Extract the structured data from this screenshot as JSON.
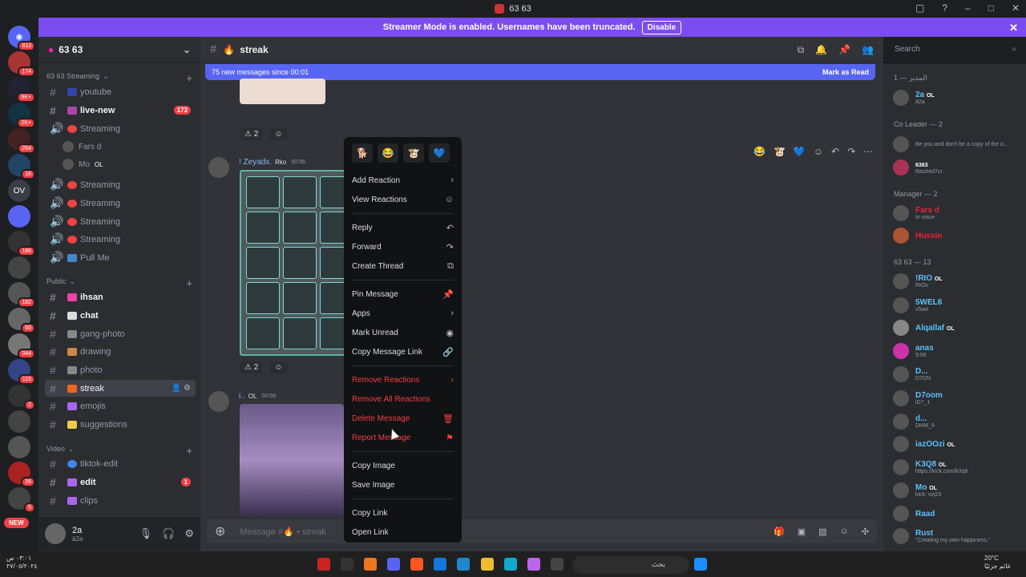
{
  "window": {
    "title": "63 63"
  },
  "banner": {
    "text": "Streamer Mode is enabled. Usernames have been truncated.",
    "button": "Disable"
  },
  "guild_badges": [
    "813",
    "174",
    "9K+",
    "2K+",
    "264",
    "16",
    "OV",
    "186",
    "182",
    "60",
    "344",
    "115",
    "2",
    "26",
    "5",
    "NEW"
  ],
  "server": {
    "name": "63 63"
  },
  "sidebar": {
    "cat_streaming": "63 63 Streaming",
    "cat_public": "Public",
    "cat_video": "Video",
    "ch_youtube": "youtube",
    "ch_livenew": "live-new",
    "ch_livenew_count": "173",
    "voice1": "Streaming",
    "voice_user1": "Fars d",
    "voice_user2": "Mo",
    "voice_user2_tag": "OL",
    "voice2": "Streaming",
    "voice3": "Streaming",
    "voice4": "Streaming",
    "voice5": "Streaming",
    "pull": "Pull Me",
    "ch_ihsan": "ihsan",
    "ch_chat": "chat",
    "ch_gang": "gang-photo",
    "ch_drawing": "drawing",
    "ch_photo": "photo",
    "ch_streak": "streak",
    "ch_emojis": "emojis",
    "ch_suggestions": "suggestions",
    "ch_tiktok": "tiktok-edit",
    "ch_edit": "edit",
    "ch_edit_count": "1",
    "ch_clips": "clips"
  },
  "user": {
    "name": "2a",
    "status": "ä2a"
  },
  "channel": {
    "name": "streak"
  },
  "search": {
    "placeholder": "Search"
  },
  "newmsg": {
    "text": "75 new messages since 00:01",
    "mark": "Mark as Read"
  },
  "messages": [
    {
      "author": "! Zeyadx.",
      "tag": "Rko",
      "time": "00:56",
      "reactions": "2"
    },
    {
      "author": "i..",
      "tag": "OL",
      "time": "00:56"
    }
  ],
  "reaction_top": "2",
  "composer": {
    "placeholder": "Message #🔥 • streak"
  },
  "context_menu": {
    "items": [
      "Add Reaction",
      "View Reactions",
      "Reply",
      "Forward",
      "Create Thread",
      "Pin Message",
      "Apps",
      "Mark Unread",
      "Copy Message Link",
      "Remove Reactions",
      "Remove All Reactions",
      "Delete Message",
      "Report Message",
      "Copy Image",
      "Save Image",
      "Copy Link",
      "Open Link"
    ]
  },
  "members": {
    "cat_admin": "المدير — 1",
    "cat_coleader": "Co Leader — 2",
    "cat_manager": "Manager — 2",
    "cat_group": "63 63 — 13",
    "list": [
      {
        "name": "2a",
        "sub": "ä2a",
        "tag": "OL"
      },
      {
        "name": "",
        "sub": "Be you and don't be a copy of the o..."
      },
      {
        "name": "",
        "sub": "Rashed7cr",
        "tag": "6363"
      },
      {
        "name": "Fars d",
        "sub": "In voice"
      },
      {
        "name": "Hussin",
        "sub": ""
      },
      {
        "name": "!RIO",
        "sub": "RIOx",
        "tag": "OL"
      },
      {
        "name": "5WEL6",
        "sub": "x5we"
      },
      {
        "name": "Alqallaf",
        "sub": "",
        "tag": "OL"
      },
      {
        "name": "anas",
        "sub": "9:06"
      },
      {
        "name": "D...",
        "sub": "D7DN"
      },
      {
        "name": "D7oom",
        "sub": "iD7_1"
      },
      {
        "name": "d...",
        "sub": "DHM_9"
      },
      {
        "name": "iazOOzi",
        "sub": "",
        "tag": "OL"
      },
      {
        "name": "K3Q8",
        "sub": "https://kick.com/k3q8",
        "tag": "OL"
      },
      {
        "name": "Mo",
        "sub": "kick: vvj23",
        "tag": "OL"
      },
      {
        "name": "Raad",
        "sub": ""
      },
      {
        "name": "Rust",
        "sub": "\"Creating my own happiness.\""
      }
    ]
  },
  "taskbar": {
    "search": "بحث",
    "time": "٠٣:٠١ ص",
    "date": "٢٧/٠٥/٢٠٢٤",
    "temp": "20°C",
    "weather": "غائم جزئيًا"
  }
}
